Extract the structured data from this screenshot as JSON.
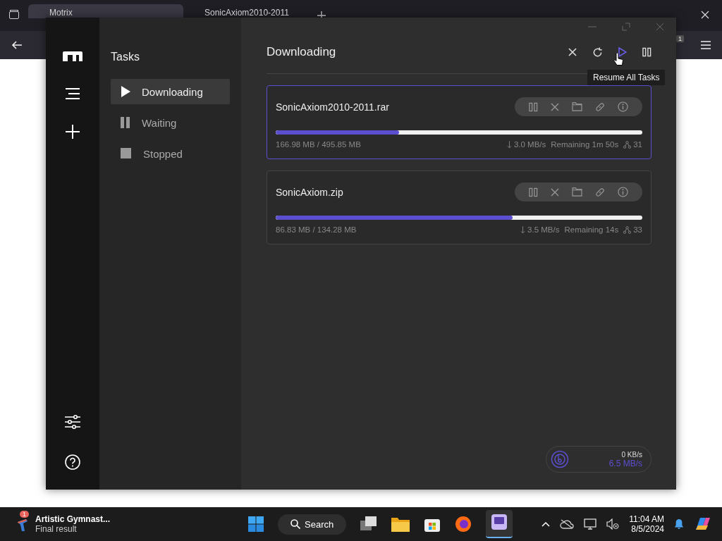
{
  "browser": {
    "tabs": [
      {
        "title": "Motrix",
        "selected": true
      },
      {
        "title": "SonicAxiom2010-2011",
        "selected": false
      }
    ],
    "extension_badge": "1"
  },
  "app": {
    "sidebar_title": "Tasks",
    "nav": [
      {
        "label": "Downloading",
        "kind": "play",
        "selected": true
      },
      {
        "label": "Waiting",
        "kind": "pause",
        "selected": false
      },
      {
        "label": "Stopped",
        "kind": "stop",
        "selected": false
      }
    ],
    "header": {
      "title": "Downloading",
      "tooltip": "Resume All Tasks"
    },
    "tasks": [
      {
        "name": "SonicAxiom2010-2011.rar",
        "selected": true,
        "level": 0.336,
        "size": "166.98 MB / 495.85 MB",
        "speed": "3.0 MB/s",
        "remaining": "Remaining 1m 50s",
        "connections": "31"
      },
      {
        "name": "SonicAxiom.zip",
        "selected": false,
        "level": 0.646,
        "size": "86.83 MB / 134.28 MB",
        "speed": "3.5 MB/s",
        "remaining": "Remaining 14s",
        "connections": "33"
      }
    ],
    "speedometer": {
      "upload": "0 KB/s",
      "download": "6.5 MB/s"
    }
  },
  "taskbar": {
    "notification": {
      "badge": "1",
      "title": "Artistic Gymnast...",
      "subtitle": "Final result"
    },
    "search": "Search",
    "time": "11:04 AM",
    "date": "8/5/2024"
  }
}
